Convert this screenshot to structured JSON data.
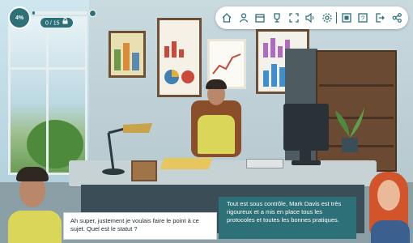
{
  "hud": {
    "progress_percent_label": "4%",
    "progress_fraction": 0.04,
    "score_label": "0 / 15",
    "lock_icon": "lock-icon"
  },
  "toolbar": {
    "icons": [
      "home-icon",
      "user-icon",
      "calendar-icon",
      "trophy-icon",
      "fullscreen-icon",
      "sound-icon",
      "settings-icon",
      "separator",
      "gallery-icon",
      "help-icon",
      "exit-icon",
      "share-icon"
    ]
  },
  "dialog": {
    "player_line": "Ah super, justement je voulais faire le point à ce sujet. Quel est le statut ?",
    "npc_line": "Tout est sous contrôle, Mark Davis est très rigoureux et a mis en place tous les protocoles et toutes les bonnes pratiques."
  },
  "colors": {
    "accent": "#2d7077",
    "shirt": "#d9d65a"
  }
}
